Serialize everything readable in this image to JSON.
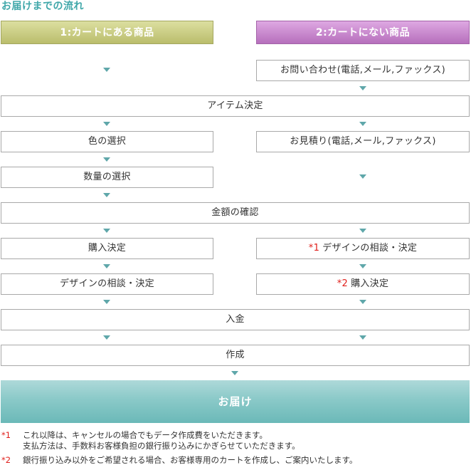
{
  "title": "お届けまでの流れ",
  "colors": {
    "title": "#3fa7a9",
    "arrow": "#5fa7aa",
    "note_mark": "#e0201c",
    "header_left": "#babd6c",
    "header_right": "#b66fbc",
    "deliver": "#8ac9c8"
  },
  "headers": {
    "left": "1:カートにある商品",
    "right": "2:カートにない商品"
  },
  "steps": {
    "inquiry": "お問い合わせ(電話,メール,ファックス)",
    "item_decision": "アイテム決定",
    "color_select": "色の選択",
    "estimate": "お見積り(電話,メール,ファックス)",
    "quantity_select": "数量の選択",
    "price_confirm": "金額の確認",
    "purchase_left": "購入決定",
    "design_right_mark": "*1",
    "design_right": "デザインの相談・決定",
    "design_left": "デザインの相談・決定",
    "purchase_right_mark": "*2",
    "purchase_right": "購入決定",
    "payment": "入金",
    "production": "作成",
    "delivery": "お届け"
  },
  "footnotes": [
    {
      "mark": "*1",
      "lines": [
        "これ以降は、キャンセルの場合でもデータ作成費をいただきます。",
        "支払方法は、手数料お客様負担の銀行振り込みにかぎらせていただきます。"
      ]
    },
    {
      "mark": "*2",
      "lines": [
        "銀行振り込み以外をご希望される場合、お客様専用のカートを作成し、ご案内いたします。"
      ]
    }
  ]
}
